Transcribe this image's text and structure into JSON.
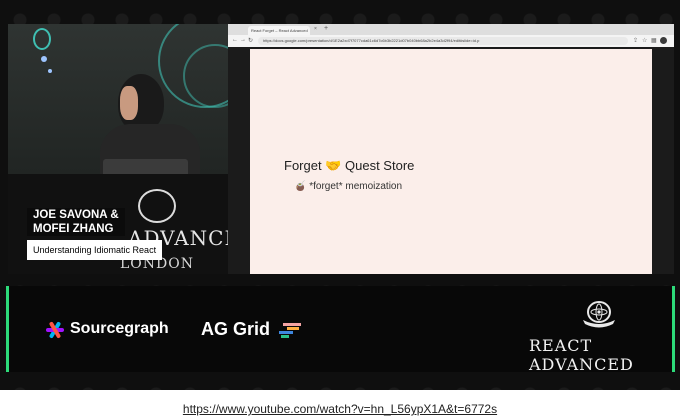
{
  "speaker": {
    "names_line1": "JOE SAVONA  &",
    "names_line2": "MOFEI ZHANG",
    "talk_title": "Understanding Idiomatic React"
  },
  "venue": {
    "podium_text": "ADVANCED",
    "podium_sub": "LONDON"
  },
  "browser": {
    "tab_title": "React Forget – React Advanced",
    "tab_close": "×",
    "tab_new": "+",
    "back": "←",
    "forward": "→",
    "reload": "↻",
    "url": "https://docs.google.com/presentation/d/1E2a2xd7f7077cda61c6d7c6b3b2221d07b040bb68a2b2e4a3d2f94/edit#slide=id.p",
    "icons": [
      "share-icon",
      "star-icon",
      "extensions-icon"
    ]
  },
  "slide": {
    "heading_left": "Forget",
    "heading_emoji": "🤝",
    "heading_right": "Quest Store",
    "bullet_emoji": "🧉",
    "bullet_text": "*forget* memoization"
  },
  "sponsors": {
    "sourcegraph": "Sourcegraph",
    "aggrid": "AG Grid",
    "brand": "REACT ADVANCED"
  },
  "colors": {
    "accent_green": "#2ddb7a",
    "slide_bg": "#fbeeea"
  },
  "footer": {
    "link_text": "https://www.youtube.com/watch?v=hn_L56ypX1A&t=6772s"
  }
}
